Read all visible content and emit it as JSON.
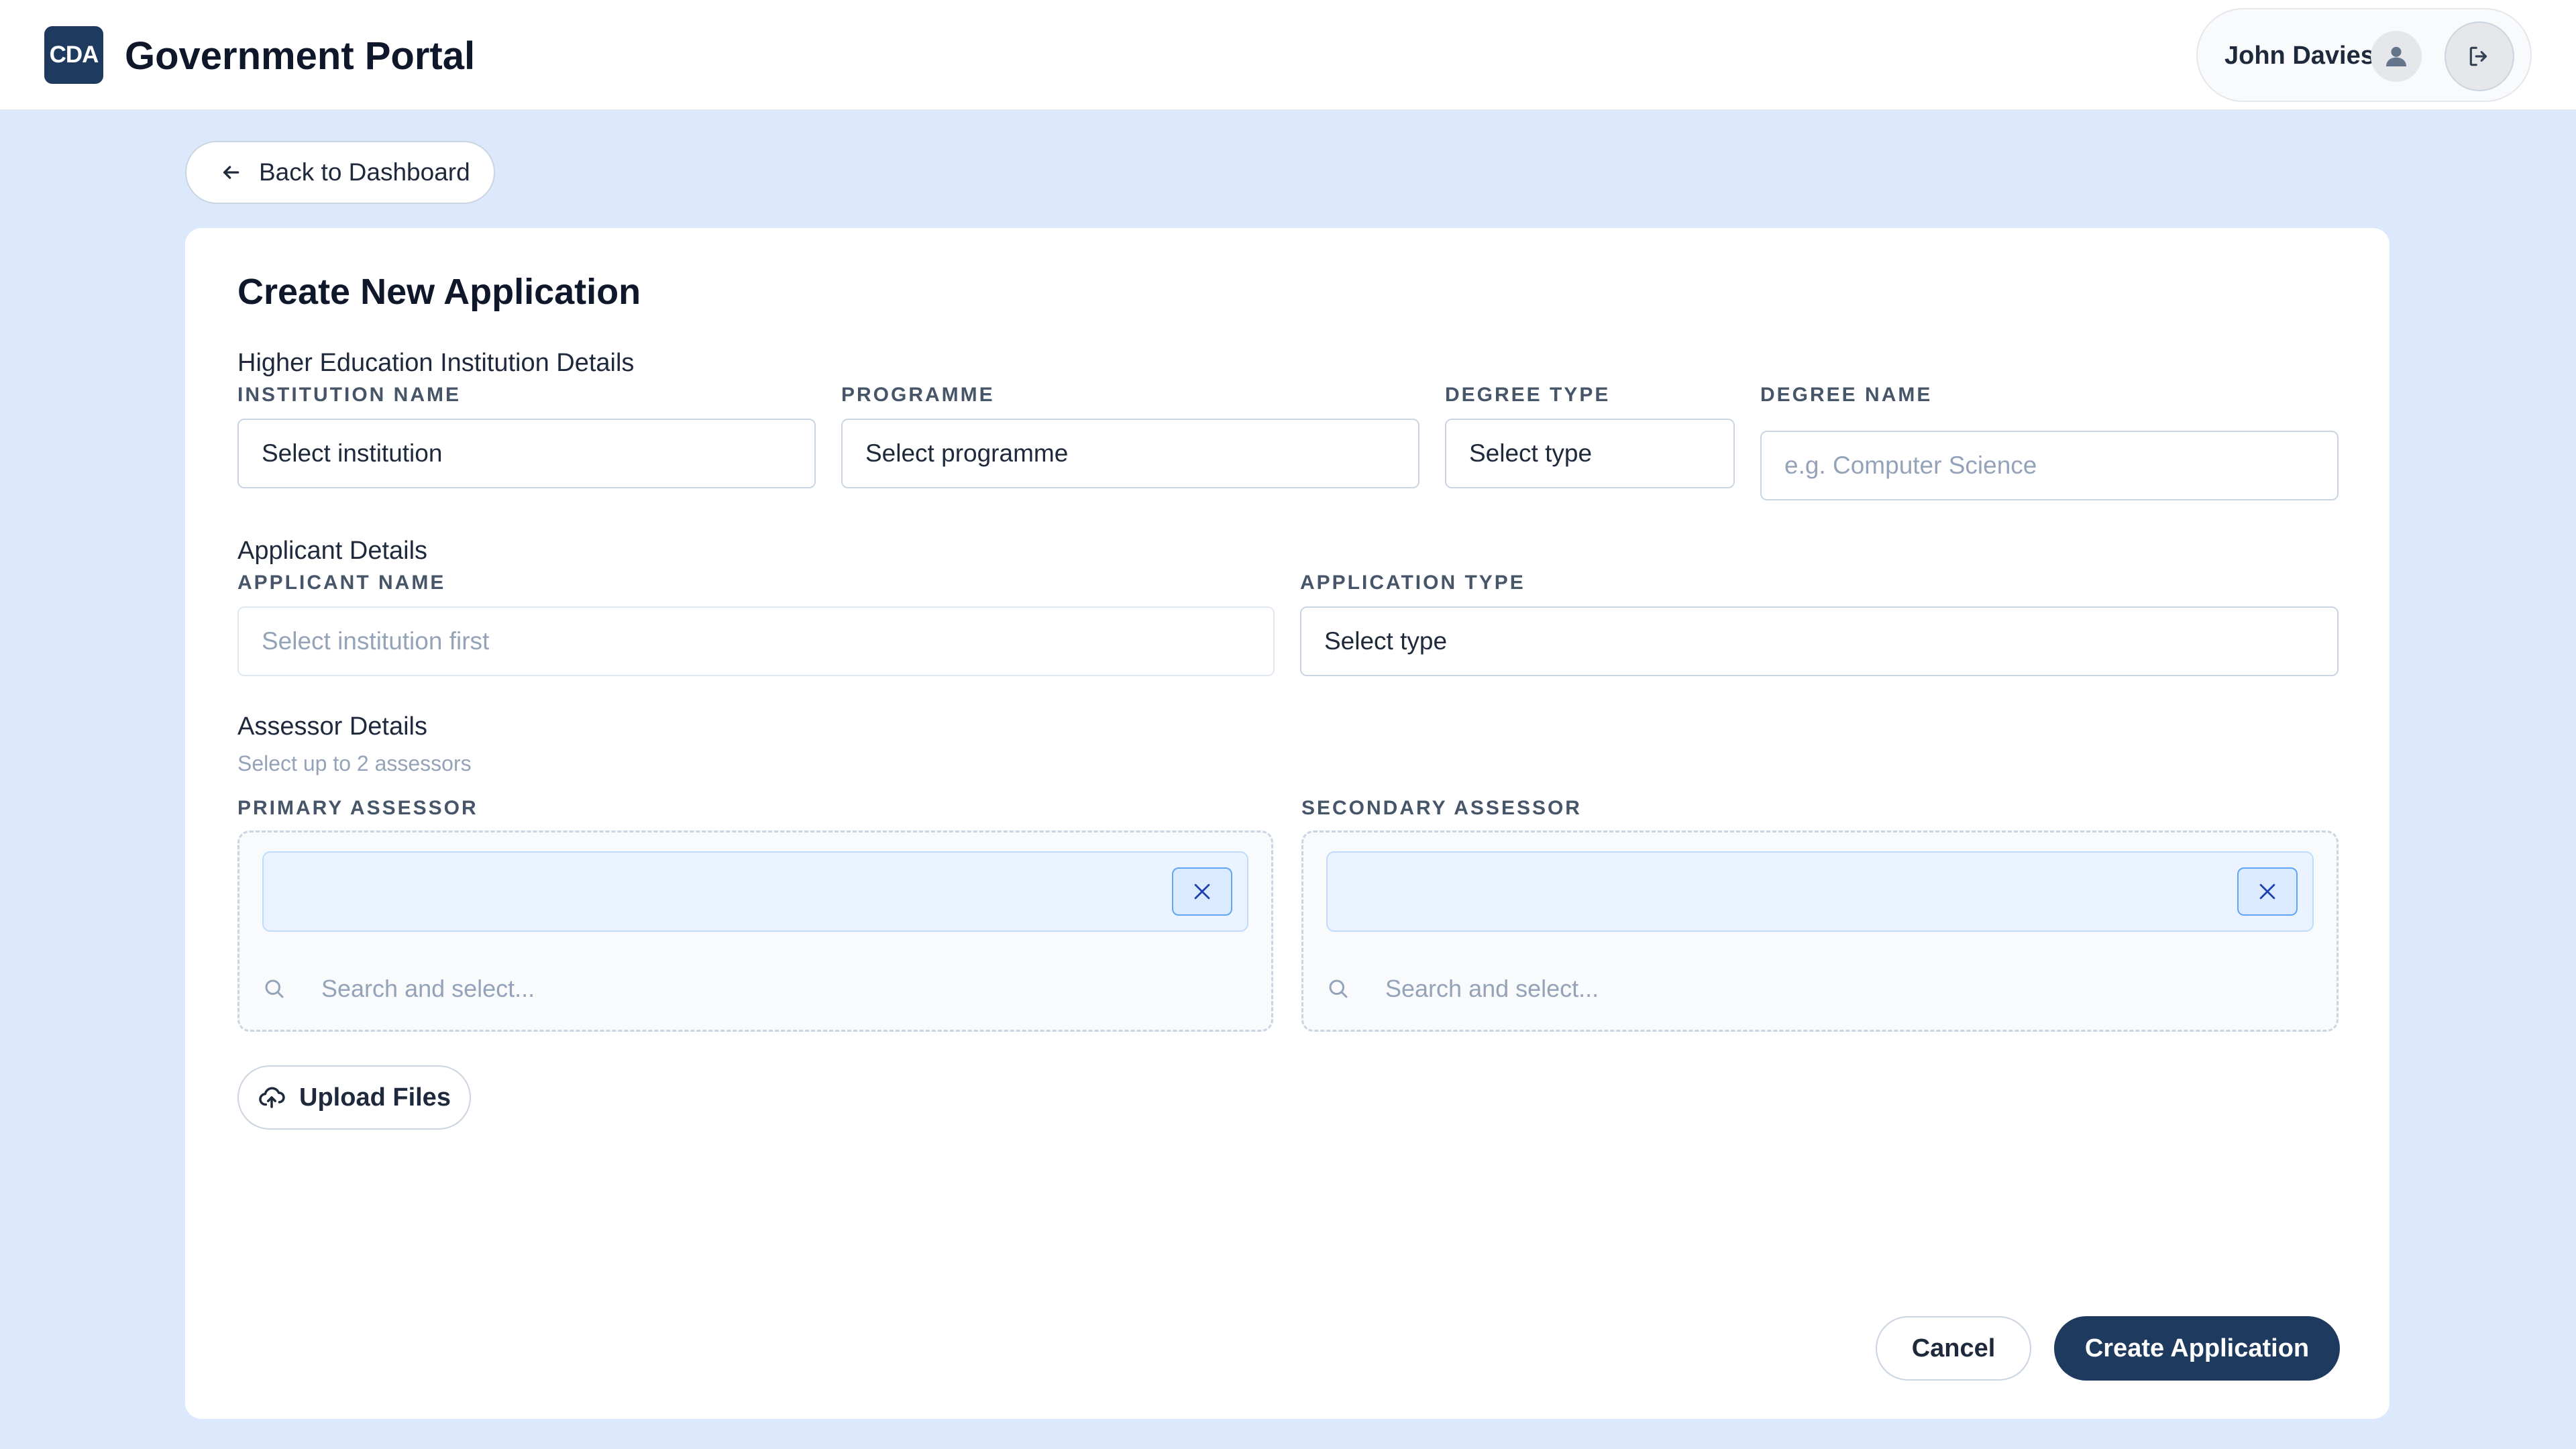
{
  "header": {
    "logo_text": "CDA",
    "title": "Government Portal",
    "user_name": "John Davies",
    "avatar_icon": "user-icon",
    "logout_icon": "logout-icon"
  },
  "back_button": {
    "label": "Back to Dashboard",
    "icon": "arrow-left-icon"
  },
  "form": {
    "title": "Create New Application",
    "institution_section": {
      "title": "Higher Education Institution Details",
      "institution_label": "INSTITUTION NAME",
      "institution_value": "Select institution",
      "programme_label": "PROGRAMME",
      "programme_value": "Select programme",
      "degree_type_label": "DEGREE TYPE",
      "degree_type_value": "Select type",
      "degree_name_label": "DEGREE NAME",
      "degree_name_placeholder": "e.g. Computer Science"
    },
    "applicant_section": {
      "title": "Applicant Details",
      "applicant_label": "APPLICANT NAME",
      "applicant_value": "Select institution first",
      "application_type_label": "APPLICATION TYPE",
      "application_type_value": "Select type"
    },
    "assessor_section": {
      "title": "Assessor Details",
      "hint": "Select up to 2 assessors",
      "primary_label": "PRIMARY ASSESSOR",
      "secondary_label": "SECONDARY ASSESSOR",
      "search_placeholder": "Search and select..."
    },
    "upload_label": "Upload Files",
    "cancel_label": "Cancel",
    "create_label": "Create Application"
  },
  "colors": {
    "background": "#dce8fb",
    "primary": "#1e3a5f",
    "chip_bg": "#eaf3ff",
    "chip_border": "#60a5fa"
  }
}
